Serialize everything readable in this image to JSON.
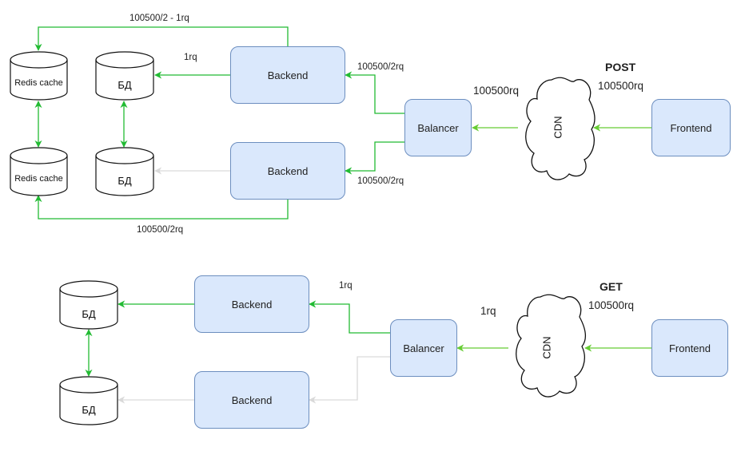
{
  "colors": {
    "active_edge": "#22bb33",
    "inactive_edge": "#d9d9d9",
    "box_fill": "#dae8fc",
    "box_stroke": "#6c8ebf"
  },
  "post": {
    "method": "POST",
    "frontend_label": "Frontend",
    "cdn_label": "CDN",
    "balancer_label": "Balancer",
    "backend_top_label": "Backend",
    "backend_bottom_label": "Backend",
    "redis_top_label": "Redis cache",
    "redis_bottom_label": "Redis cache",
    "db_top_label": "БД",
    "db_bottom_label": "БД",
    "frontend_to_cdn_rate": "100500rq",
    "cdn_to_balancer_rate": "100500rq",
    "balancer_to_backend_top_rate": "100500/2rq",
    "balancer_to_backend_bottom_rate": "100500/2rq",
    "backend_top_to_db_rate": "1rq",
    "backend_top_to_redis_rate": "100500/2 - 1rq",
    "backend_bottom_to_redis_rate": "100500/2rq"
  },
  "get": {
    "method": "GET",
    "frontend_label": "Frontend",
    "cdn_label": "CDN",
    "balancer_label": "Balancer",
    "backend_top_label": "Backend",
    "backend_bottom_label": "Backend",
    "db_top_label": "БД",
    "db_bottom_label": "БД",
    "frontend_to_cdn_rate": "100500rq",
    "cdn_to_balancer_rate": "1rq",
    "balancer_to_backend_top_rate": "1rq"
  }
}
